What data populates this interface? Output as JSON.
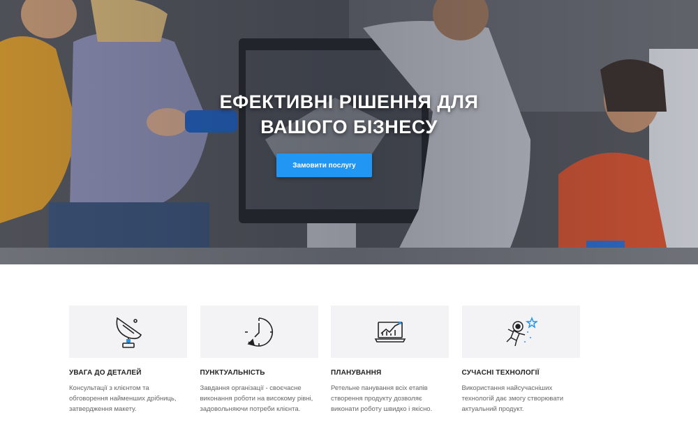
{
  "hero": {
    "title_line1": "ЕФЕКТИВНІ РІШЕННЯ ДЛЯ",
    "title_line2": "ВАШОГО БІЗНЕСУ",
    "button_label": "Замовити послугу"
  },
  "features": [
    {
      "icon": "satellite-dish-icon",
      "title": "УВАГА ДО ДЕТАЛЕЙ",
      "text": "Консультації з клієнтом та обговорення найменших дрібниць, затвердження макету."
    },
    {
      "icon": "clock-icon",
      "title": "ПУНКТУАЛЬНІСТЬ",
      "text": "Завдання організації - своєчасне виконання роботи на високому рівні, задовольняючи потреби клієнта."
    },
    {
      "icon": "laptop-chart-icon",
      "title": "ПЛАНУВАННЯ",
      "text": "Ретельне панування всіх етапів створення продукту дозволяє виконати роботу швидко і якісно."
    },
    {
      "icon": "astronaut-icon",
      "title": "СУЧАСНІ ТЕХНОЛОГІЇ",
      "text": "Використання найсучасніших технологій дає змогу створювати актуальний продукт."
    }
  ],
  "colors": {
    "accent": "#2196f3",
    "feature_bg": "#f3f3f6",
    "title": "#222222",
    "text": "#666666"
  }
}
